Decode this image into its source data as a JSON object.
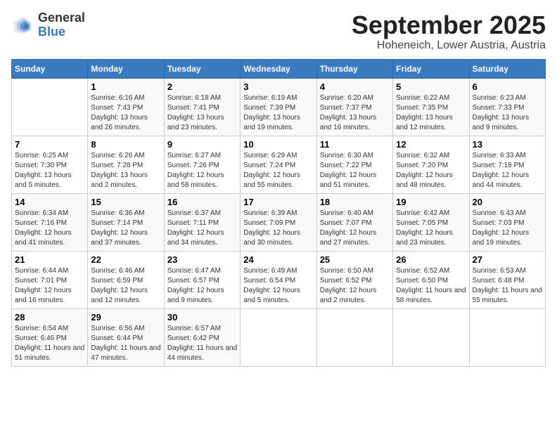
{
  "logo": {
    "general": "General",
    "blue": "Blue"
  },
  "title": {
    "month": "September 2025",
    "location": "Hoheneich, Lower Austria, Austria"
  },
  "header": {
    "days": [
      "Sunday",
      "Monday",
      "Tuesday",
      "Wednesday",
      "Thursday",
      "Friday",
      "Saturday"
    ]
  },
  "weeks": [
    [
      {
        "day": "",
        "info": ""
      },
      {
        "day": "1",
        "info": "Sunrise: 6:16 AM\nSunset: 7:43 PM\nDaylight: 13 hours and 26 minutes."
      },
      {
        "day": "2",
        "info": "Sunrise: 6:18 AM\nSunset: 7:41 PM\nDaylight: 13 hours and 23 minutes."
      },
      {
        "day": "3",
        "info": "Sunrise: 6:19 AM\nSunset: 7:39 PM\nDaylight: 13 hours and 19 minutes."
      },
      {
        "day": "4",
        "info": "Sunrise: 6:20 AM\nSunset: 7:37 PM\nDaylight: 13 hours and 16 minutes."
      },
      {
        "day": "5",
        "info": "Sunrise: 6:22 AM\nSunset: 7:35 PM\nDaylight: 13 hours and 12 minutes."
      },
      {
        "day": "6",
        "info": "Sunrise: 6:23 AM\nSunset: 7:33 PM\nDaylight: 13 hours and 9 minutes."
      }
    ],
    [
      {
        "day": "7",
        "info": "Sunrise: 6:25 AM\nSunset: 7:30 PM\nDaylight: 13 hours and 5 minutes."
      },
      {
        "day": "8",
        "info": "Sunrise: 6:26 AM\nSunset: 7:28 PM\nDaylight: 13 hours and 2 minutes."
      },
      {
        "day": "9",
        "info": "Sunrise: 6:27 AM\nSunset: 7:26 PM\nDaylight: 12 hours and 58 minutes."
      },
      {
        "day": "10",
        "info": "Sunrise: 6:29 AM\nSunset: 7:24 PM\nDaylight: 12 hours and 55 minutes."
      },
      {
        "day": "11",
        "info": "Sunrise: 6:30 AM\nSunset: 7:22 PM\nDaylight: 12 hours and 51 minutes."
      },
      {
        "day": "12",
        "info": "Sunrise: 6:32 AM\nSunset: 7:20 PM\nDaylight: 12 hours and 48 minutes."
      },
      {
        "day": "13",
        "info": "Sunrise: 6:33 AM\nSunset: 7:18 PM\nDaylight: 12 hours and 44 minutes."
      }
    ],
    [
      {
        "day": "14",
        "info": "Sunrise: 6:34 AM\nSunset: 7:16 PM\nDaylight: 12 hours and 41 minutes."
      },
      {
        "day": "15",
        "info": "Sunrise: 6:36 AM\nSunset: 7:14 PM\nDaylight: 12 hours and 37 minutes."
      },
      {
        "day": "16",
        "info": "Sunrise: 6:37 AM\nSunset: 7:11 PM\nDaylight: 12 hours and 34 minutes."
      },
      {
        "day": "17",
        "info": "Sunrise: 6:39 AM\nSunset: 7:09 PM\nDaylight: 12 hours and 30 minutes."
      },
      {
        "day": "18",
        "info": "Sunrise: 6:40 AM\nSunset: 7:07 PM\nDaylight: 12 hours and 27 minutes."
      },
      {
        "day": "19",
        "info": "Sunrise: 6:42 AM\nSunset: 7:05 PM\nDaylight: 12 hours and 23 minutes."
      },
      {
        "day": "20",
        "info": "Sunrise: 6:43 AM\nSunset: 7:03 PM\nDaylight: 12 hours and 19 minutes."
      }
    ],
    [
      {
        "day": "21",
        "info": "Sunrise: 6:44 AM\nSunset: 7:01 PM\nDaylight: 12 hours and 16 minutes."
      },
      {
        "day": "22",
        "info": "Sunrise: 6:46 AM\nSunset: 6:59 PM\nDaylight: 12 hours and 12 minutes."
      },
      {
        "day": "23",
        "info": "Sunrise: 6:47 AM\nSunset: 6:57 PM\nDaylight: 12 hours and 9 minutes."
      },
      {
        "day": "24",
        "info": "Sunrise: 6:49 AM\nSunset: 6:54 PM\nDaylight: 12 hours and 5 minutes."
      },
      {
        "day": "25",
        "info": "Sunrise: 6:50 AM\nSunset: 6:52 PM\nDaylight: 12 hours and 2 minutes."
      },
      {
        "day": "26",
        "info": "Sunrise: 6:52 AM\nSunset: 6:50 PM\nDaylight: 11 hours and 58 minutes."
      },
      {
        "day": "27",
        "info": "Sunrise: 6:53 AM\nSunset: 6:48 PM\nDaylight: 11 hours and 55 minutes."
      }
    ],
    [
      {
        "day": "28",
        "info": "Sunrise: 6:54 AM\nSunset: 6:46 PM\nDaylight: 11 hours and 51 minutes."
      },
      {
        "day": "29",
        "info": "Sunrise: 6:56 AM\nSunset: 6:44 PM\nDaylight: 11 hours and 47 minutes."
      },
      {
        "day": "30",
        "info": "Sunrise: 6:57 AM\nSunset: 6:42 PM\nDaylight: 11 hours and 44 minutes."
      },
      {
        "day": "",
        "info": ""
      },
      {
        "day": "",
        "info": ""
      },
      {
        "day": "",
        "info": ""
      },
      {
        "day": "",
        "info": ""
      }
    ]
  ]
}
